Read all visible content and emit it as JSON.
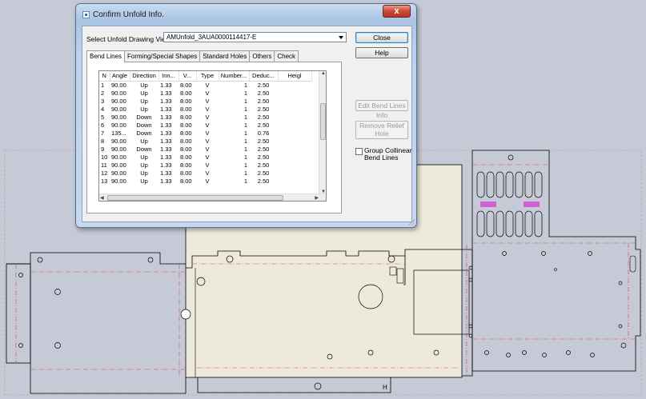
{
  "dialog": {
    "title": "Confirm Unfold Info.",
    "close_glyph": "x",
    "select_label": "Select Unfold Drawing View",
    "select_value": "AMUnfold_3AUA0000114417-E",
    "buttons": {
      "close": "Close",
      "help": "Help",
      "edit_bend": "Edit Bend Lines Info",
      "remove_relief": "Remove Relief Hole"
    },
    "checkbox_label": "Group Collinear Bend Lines",
    "tabs": [
      "Bend Lines",
      "Forming/Special Shapes",
      "Standard Holes",
      "Others",
      "Check"
    ],
    "columns": [
      "N",
      "Angle",
      "Direction",
      "Inn...",
      "V...",
      "Type",
      "Number...",
      "Deduc...",
      "Heigl"
    ],
    "rows": [
      [
        "1",
        "90.00",
        "Up",
        "1.33",
        "8.00",
        "V",
        "1",
        "2.50"
      ],
      [
        "2",
        "90.00",
        "Up",
        "1.33",
        "8.00",
        "V",
        "1",
        "2.50"
      ],
      [
        "3",
        "90.00",
        "Up",
        "1.33",
        "8.00",
        "V",
        "1",
        "2.50"
      ],
      [
        "4",
        "90.00",
        "Up",
        "1.33",
        "8.00",
        "V",
        "1",
        "2.50"
      ],
      [
        "5",
        "90.00",
        "Down",
        "1.33",
        "8.00",
        "V",
        "1",
        "2.50"
      ],
      [
        "6",
        "90.00",
        "Down",
        "1.33",
        "8.00",
        "V",
        "1",
        "2.50"
      ],
      [
        "7",
        "135...",
        "Down",
        "1.33",
        "8.00",
        "V",
        "1",
        "0.76"
      ],
      [
        "8",
        "90.00",
        "Up",
        "1.33",
        "8.00",
        "V",
        "1",
        "2.50"
      ],
      [
        "9",
        "90.00",
        "Down",
        "1.33",
        "8.00",
        "V",
        "1",
        "2.50"
      ],
      [
        "10",
        "90.00",
        "Up",
        "1.33",
        "8.00",
        "V",
        "1",
        "2.50"
      ],
      [
        "11",
        "90.00",
        "Up",
        "1.33",
        "8.00",
        "V",
        "1",
        "2.50"
      ],
      [
        "12",
        "90.00",
        "Up",
        "1.33",
        "8.00",
        "V",
        "1",
        "2.50"
      ],
      [
        "13",
        "90.00",
        "Up",
        "1.33",
        "8.00",
        "V",
        "1",
        "2.50"
      ]
    ]
  },
  "drawing": {
    "colors": {
      "background": "#c5cad6",
      "outline": "#000000",
      "centerline": "#e0404c",
      "highlight": "#d14fd1",
      "panel_fill": "#eeeadb"
    },
    "label": "H"
  }
}
